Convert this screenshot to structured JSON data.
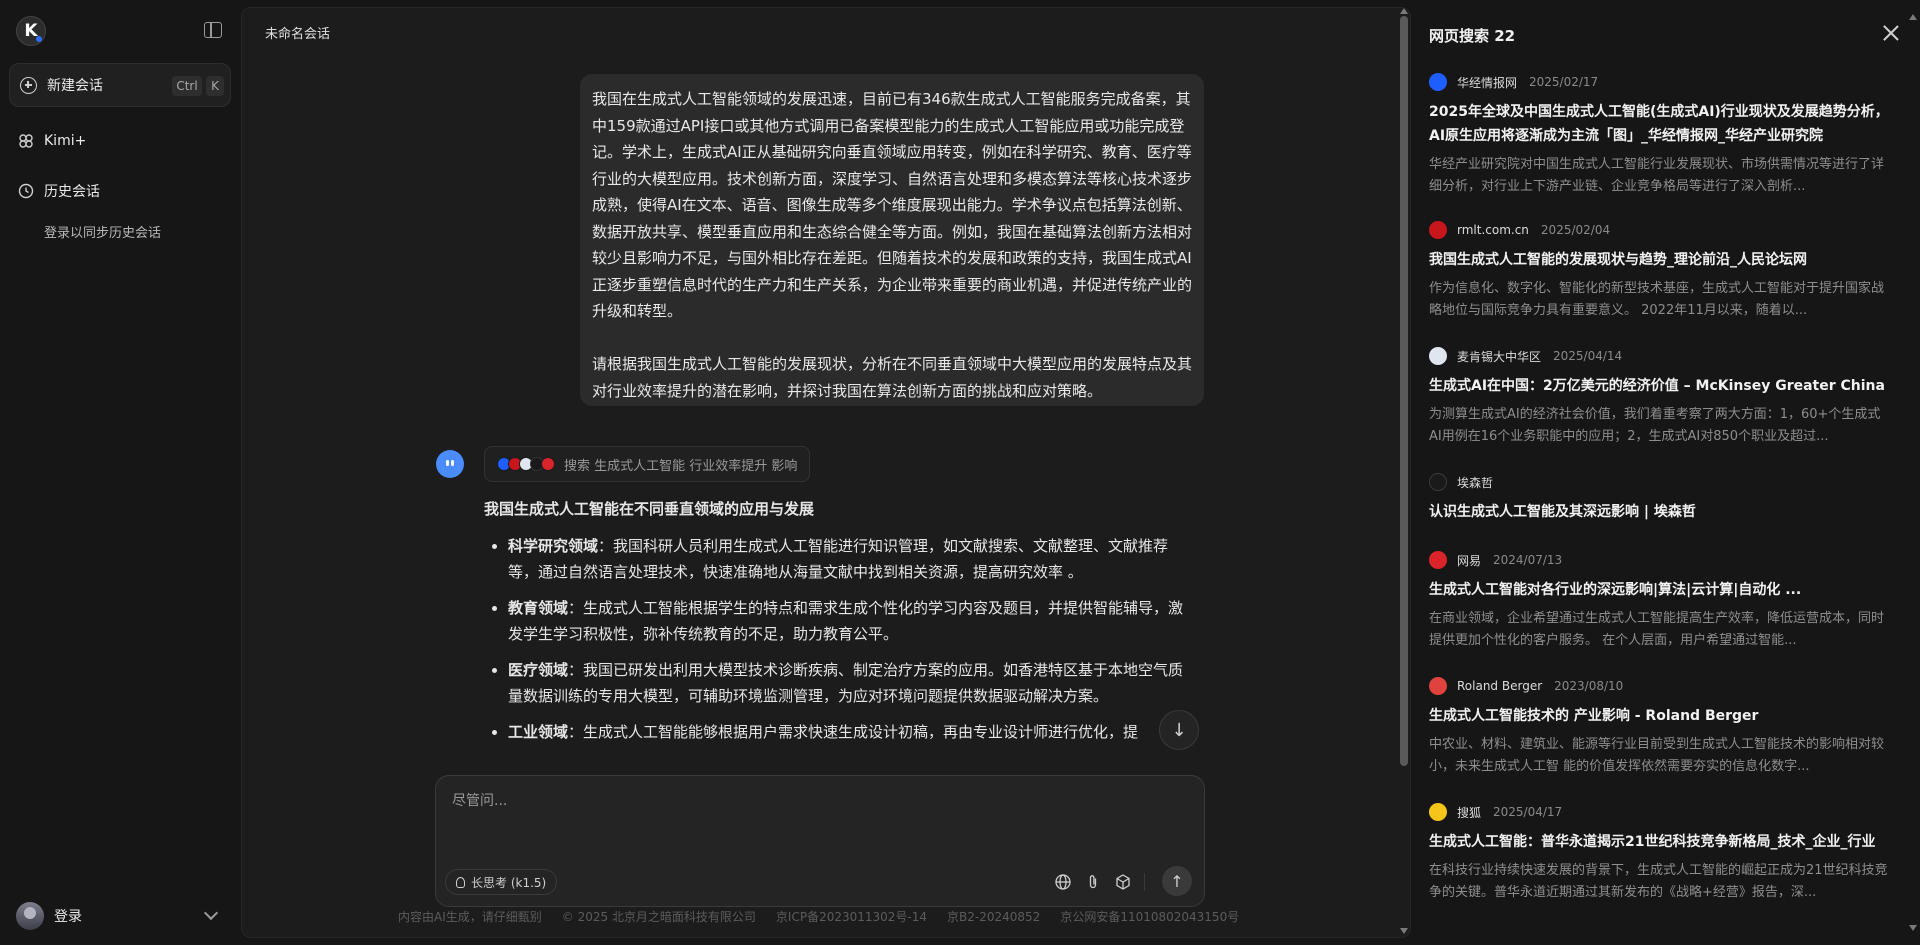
{
  "sidebar": {
    "logo_text": "K",
    "new_chat_label": "新建会话",
    "shortcut_ctrl": "Ctrl",
    "shortcut_key": "K",
    "kimi_plus_label": "Kimi+",
    "history_label": "历史会话",
    "history_hint": "登录以同步历史会话",
    "login_label": "登录"
  },
  "main": {
    "chat_title": "未命名会话",
    "user_message": {
      "paragraph1": "我国在生成式人工智能领域的发展迅速，目前已有346款生成式人工智能服务完成备案，其中159款通过API接口或其他方式调用已备案模型能力的生成式人工智能应用或功能完成登记。学术上，生成式AI正从基础研究向垂直领域应用转变，例如在科学研究、教育、医疗等行业的大模型应用。技术创新方面，深度学习、自然语言处理和多模态算法等核心技术逐步成熟，使得AI在文本、语音、图像生成等多个维度展现出能力。学术争议点包括算法创新、数据开放共享、模型垂直应用和生态综合健全等方面。例如，我国在基础算法创新方法相对较少且影响力不足，与国外相比存在差距。但随着技术的发展和政策的支持，我国生成式AI正逐步重塑信息时代的生产力和生产关系，为企业带来重要的商业机遇，并促进传统产业的升级和转型。",
      "paragraph2": "请根据我国生成式人工智能的发展现状，分析在不同垂直领域中大模型应用的发展特点及其对行业效率提升的潜在影响，并探讨我国在算法创新方面的挑战和应对策略。"
    },
    "search_query": "搜索 生成式人工智能 行业效率提升 影响",
    "answer": {
      "heading": "我国生成式人工智能在不同垂直领域的应用与发展",
      "items": [
        {
          "label": "科学研究领域",
          "text": "：我国科研人员利用生成式人工智能进行知识管理，如文献搜索、文献整理、文献推荐等，通过自然语言处理技术，快速准确地从海量文献中找到相关资源，提高研究效率 。"
        },
        {
          "label": "教育领域",
          "text": "：生成式人工智能根据学生的特点和需求生成个性化的学习内容及题目，并提供智能辅导，激发学生学习积极性，弥补传统教育的不足，助力教育公平。"
        },
        {
          "label": "医疗领域",
          "text": "：我国已研发出利用大模型技术诊断疾病、制定治疗方案的应用。如香港特区基于本地空气质量数据训练的专用大模型，可辅助环境监测管理，为应对环境问题提供数据驱动解决方案。"
        },
        {
          "label": "工业领域",
          "text": "：生成式人工智能能够根据用户需求快速生成设计初稿，再由专业设计师进行优化，提"
        }
      ]
    },
    "input_placeholder": "尽管问...",
    "think_button": "长思考 (k1.5)",
    "footer": [
      "内容由AI生成，请仔细甄别",
      "© 2025 北京月之暗面科技有限公司",
      "京ICP备2023011302号-14",
      "京B2-20240852",
      "京公网安备11010802043150号"
    ]
  },
  "panel": {
    "title": "网页搜索 22",
    "results": [
      {
        "source": "华经情报网",
        "date": "2025/02/17",
        "icon_color": "#1e5eff",
        "title": "2025年全球及中国生成式人工智能(生成式AI)行业现状及发展趋势分析，AI原生应用将逐渐成为主流「图」_华经情报网_华经产业研究院",
        "desc": "华经产业研究院对中国生成式人工智能行业发展现状、市场供需情况等进行了详细分析，对行业上下游产业链、企业竞争格局等进行了深入剖析..."
      },
      {
        "source": "rmlt.com.cn",
        "date": "2025/02/04",
        "icon_color": "#c8161d",
        "title": "我国生成式人工智能的发展现状与趋势_理论前沿_人民论坛网",
        "desc": "作为信息化、数字化、智能化的新型技术基座，生成式人工智能对于提升国家战略地位与国际竞争力具有重要意义。 2022年11月以来，随着以..."
      },
      {
        "source": "麦肯锡大中华区",
        "date": "2025/04/14",
        "icon_color": "#dfe6f0",
        "title": "生成式AI在中国：2万亿美元的经济价值 – McKinsey Greater China",
        "desc": "为测算生成式AI的经济社会价值，我们着重考察了两大方面：1，60+个生成式AI用例在16个业务职能中的应用；2，生成式AI对850个职业及超过..."
      },
      {
        "source": "埃森哲",
        "date": "",
        "icon_color": "#1a1a1a",
        "title": "认识生成式人工智能及其深远影响 | 埃森哲",
        "desc": ""
      },
      {
        "source": "网易",
        "date": "2024/07/13",
        "icon_color": "#d8242a",
        "title": "生成式人工智能对各行业的深远影响|算法|云计算|自动化 ...",
        "desc": "在商业领域，企业希望通过生成式人工智能提高生产效率，降低运营成本，同时提供更加个性化的客户服务。 在个人层面，用户希望通过智能..."
      },
      {
        "source": "Roland Berger",
        "date": "2023/08/10",
        "icon_color": "#e0423d",
        "title": "生成式人工智能技术的 产业影响 - Roland Berger",
        "desc": "中农业、材料、建筑业、能源等行业目前受到生成式人工智能技术的影响相对较小，未来生成式人工智 能的价值发挥依然需要夯实的信息化数字..."
      },
      {
        "source": "搜狐",
        "date": "2025/04/17",
        "icon_color": "#f5c518",
        "title": "生成式人工智能：普华永道揭示21世纪科技竞争新格局_技术_企业_行业",
        "desc": "在科技行业持续快速发展的背景下，生成式人工智能的崛起正成为21世纪科技竞争的关键。普华永道近期通过其新发布的《战略+经营》报告，深..."
      }
    ]
  },
  "colors": {
    "accent": "#4a8cff",
    "background": "#161616",
    "surface": "#1c1c1c"
  }
}
